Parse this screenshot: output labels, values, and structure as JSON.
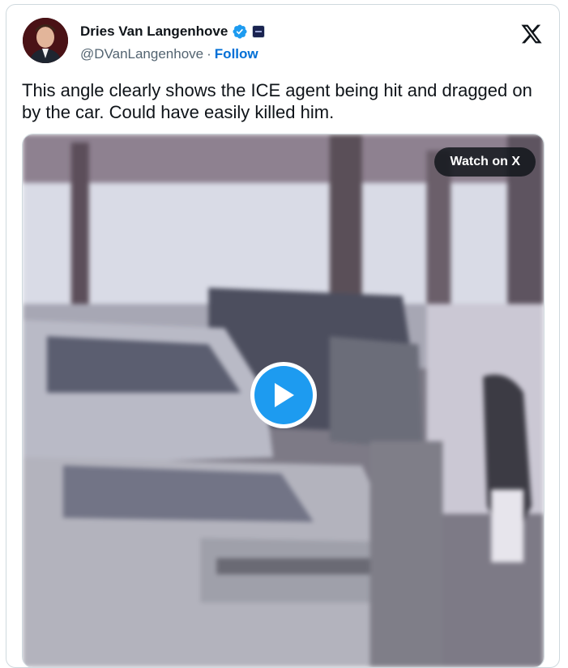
{
  "author": {
    "name": "Dries Van Langenhove",
    "handle": "@DVanLangenhove",
    "separator": "·",
    "follow_label": "Follow"
  },
  "icons": {
    "verified": "verified-badge-icon",
    "affiliation": "affiliation-badge-icon",
    "platform": "x-logo-icon",
    "play": "play-icon"
  },
  "tweet": {
    "text": "This angle clearly shows the ICE agent being hit and dragged on by the car. Could have easily killed him."
  },
  "media": {
    "watch_label": "Watch on X"
  },
  "colors": {
    "follow": "#006fd6",
    "verified": "#1d9bf0",
    "play": "#1d9bf0"
  }
}
